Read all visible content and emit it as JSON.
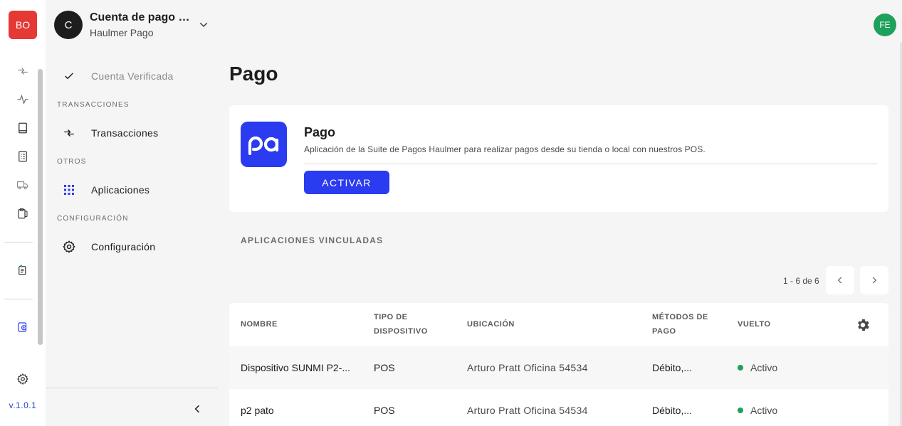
{
  "org": {
    "badge": "BO"
  },
  "version": "v.1.0.1",
  "account": {
    "avatar": "C",
    "name": "Cuenta de pago R...",
    "subtitle": "Haulmer Pago"
  },
  "user": {
    "avatar": "FE"
  },
  "sidebar": {
    "verified": "Cuenta Verificada",
    "sections": [
      {
        "title": "TRANSACCIONES",
        "items": [
          {
            "label": "Transacciones",
            "icon": "transfer-icon"
          }
        ]
      },
      {
        "title": "OTROS",
        "items": [
          {
            "label": "Aplicaciones",
            "icon": "grid-icon"
          }
        ]
      },
      {
        "title": "CONFIGURACIÓN",
        "items": [
          {
            "label": "Configuración",
            "icon": "gear-icon"
          }
        ]
      }
    ]
  },
  "page": {
    "title": "Pago"
  },
  "app": {
    "logo_text": "pa",
    "title": "Pago",
    "description": "Aplicación de la Suite de Pagos Haulmer para realizar pagos desde su tienda o local con nuestros POS.",
    "activate_label": "ACTIVAR"
  },
  "linked": {
    "title": "APLICACIONES VINCULADAS",
    "pagination": "1 - 6 de 6",
    "columns": {
      "name": "NOMBRE",
      "device_l1": "TIPO DE",
      "device_l2": "DISPOSITIVO",
      "location": "UBICACIÓN",
      "methods_l1": "MÉTODOS DE",
      "methods_l2": "PAGO",
      "change": "VUELTO"
    },
    "rows": [
      {
        "name": "Dispositivo SUNMI P2-...",
        "device": "POS",
        "location": "Arturo Pratt Oficina 54534",
        "methods": "Débito,...",
        "change": "Activo"
      },
      {
        "name": "p2 pato",
        "device": "POS",
        "location": "Arturo Pratt Oficina 54534",
        "methods": "Débito,...",
        "change": "Activo"
      }
    ]
  },
  "colors": {
    "primary": "#2A3BF0",
    "org_badge": "#E53935",
    "user_avatar": "#1EA15A",
    "status_active": "#1EA15A"
  }
}
